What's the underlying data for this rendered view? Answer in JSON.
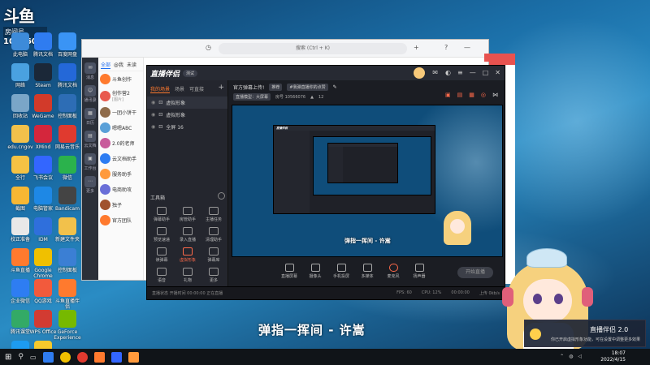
{
  "overlay": {
    "logo": "斗鱼",
    "room_label": "房间号",
    "room_number": "10566076"
  },
  "desktop_icons": [
    {
      "label": "此电脑",
      "color": "#3d8bd9"
    },
    {
      "label": "腾讯文档",
      "color": "#2f7cf0"
    },
    {
      "label": "百度网盘",
      "color": "#3a94f5"
    },
    {
      "label": "网络",
      "color": "#4aa1e0"
    },
    {
      "label": "Steam",
      "color": "#1b2838"
    },
    {
      "label": "腾讯文档",
      "color": "#2468d8"
    },
    {
      "label": "回收站",
      "color": "#7aa6c8"
    },
    {
      "label": "WeGame",
      "color": "#d23a2a"
    },
    {
      "label": "控制面板",
      "color": "#2d6db5"
    },
    {
      "label": "edu.cngov",
      "color": "#f2c14b"
    },
    {
      "label": "XMind",
      "color": "#d4263c"
    },
    {
      "label": "网易云音乐",
      "color": "#e03a2f"
    },
    {
      "label": "全行",
      "color": "#f5c244"
    },
    {
      "label": "飞书会议",
      "color": "#3366ff"
    },
    {
      "label": "微信",
      "color": "#2bb24c"
    },
    {
      "label": "截图",
      "color": "#f7b733"
    },
    {
      "label": "电脑管家",
      "color": "#1e88e5"
    },
    {
      "label": "Bandicam",
      "color": "#444"
    },
    {
      "label": "校正准备",
      "color": "#e8e8e8"
    },
    {
      "label": "IDM",
      "color": "#2f6fdc"
    },
    {
      "label": "新建文件夹",
      "color": "#f2c14b"
    },
    {
      "label": "斗鱼直播",
      "color": "#ff7a2e"
    },
    {
      "label": "Google Chrome",
      "color": "#f0c000"
    },
    {
      "label": "控制面板",
      "color": "#3b7fd4"
    },
    {
      "label": "企业微信",
      "color": "#2e7df2"
    },
    {
      "label": "QQ游戏",
      "color": "#f25a3c"
    },
    {
      "label": "斗鱼直播伴侣",
      "color": "#ff7a2e"
    },
    {
      "label": "腾讯课堂",
      "color": "#33aa66"
    },
    {
      "label": "WPS Office",
      "color": "#d23b32"
    },
    {
      "label": "GeForce Experience",
      "color": "#76b900"
    },
    {
      "label": "腾讯QQ",
      "color": "#1d9bf0"
    },
    {
      "label": "YY语音",
      "color": "#f6c92c"
    }
  ],
  "chat": {
    "search_placeholder": "搜索 (Ctrl + K)",
    "tabs": [
      "全部",
      "@我",
      "未读"
    ],
    "rail": [
      {
        "label": "消息"
      },
      {
        "label": "通讯录"
      },
      {
        "label": "日历"
      },
      {
        "label": "云文档"
      },
      {
        "label": "工作台"
      },
      {
        "label": "更多"
      }
    ],
    "items": [
      {
        "name": "斗鱼创作",
        "preview": "",
        "color": "#ff7a2e"
      },
      {
        "name": "创作营2",
        "preview": "[图片]",
        "color": "#e85a4f"
      },
      {
        "name": "一团小饼干",
        "preview": "",
        "color": "#8f6b4a"
      },
      {
        "name": "嗯嗯ABC",
        "preview": "",
        "color": "#5aa0d8"
      },
      {
        "name": "2.0的老师",
        "preview": "",
        "color": "#c85b9b"
      },
      {
        "name": "云文档助手",
        "preview": "",
        "color": "#2e7df2"
      },
      {
        "name": "服务助手",
        "preview": "",
        "color": "#ff9a3c"
      },
      {
        "name": "电商助攻",
        "preview": "",
        "color": "#6a6fd8"
      },
      {
        "name": "独子",
        "preview": "",
        "color": "#a0522d"
      },
      {
        "name": "官方团队",
        "preview": "",
        "color": "#ff7a2e"
      }
    ]
  },
  "app": {
    "logo": "直播伴侣",
    "version": "测试",
    "side_tabs": [
      "我的场景",
      "场景",
      "可直接"
    ],
    "scenes": [
      {
        "label": "虚拟形象"
      },
      {
        "label": "虚拟形象"
      },
      {
        "label": "全屏 16"
      }
    ],
    "tools_title": "工具箱",
    "tools": [
      {
        "label": "弹幕助手",
        "red": false
      },
      {
        "label": "房管助手",
        "red": false
      },
      {
        "label": "主播任务",
        "red": false
      },
      {
        "label": "预览速递",
        "red": false
      },
      {
        "label": "录入直播",
        "red": false
      },
      {
        "label": "清理助手",
        "red": false
      },
      {
        "label": "读弹幕",
        "red": false
      },
      {
        "label": "虚拟形象",
        "red": true
      },
      {
        "label": "弹幕库",
        "red": false
      },
      {
        "label": "语音",
        "red": false
      },
      {
        "label": "礼物",
        "red": false
      },
      {
        "label": "更多",
        "red": false
      }
    ],
    "stream_title": "官方弹幕上传!",
    "tag1": "推荐",
    "tag2": "#我弹直播你的点赞",
    "category": "直播模型：大屏幕",
    "room": "房号 10566076",
    "heat": "12",
    "preview_caption": "弹指一挥间 - 许嵩",
    "controls": [
      {
        "label": "直播屏幕",
        "mic": false
      },
      {
        "label": "摄像头",
        "mic": false
      },
      {
        "label": "手机投屏",
        "mic": false
      },
      {
        "label": "多媒体",
        "mic": false
      },
      {
        "label": "麦克风",
        "mic": true
      },
      {
        "label": "扬声器",
        "mic": false
      }
    ],
    "start_button": "开始直播",
    "status": {
      "left": "直播状态  开播时间  00:00:00  正在直播",
      "fps": "FPS: 60",
      "cpu": "CPU: 12%",
      "time": "00:00:00",
      "net": "上传 0kb/s"
    }
  },
  "bottom_caption": "弹指一挥间 - 许嵩",
  "notification": {
    "title": "直播伴侣 2.0",
    "body": "你已开启虚拟形象功能，可在设置中调整更多效果"
  },
  "taskbar": {
    "time": "18:07",
    "date": "2022/4/15"
  }
}
